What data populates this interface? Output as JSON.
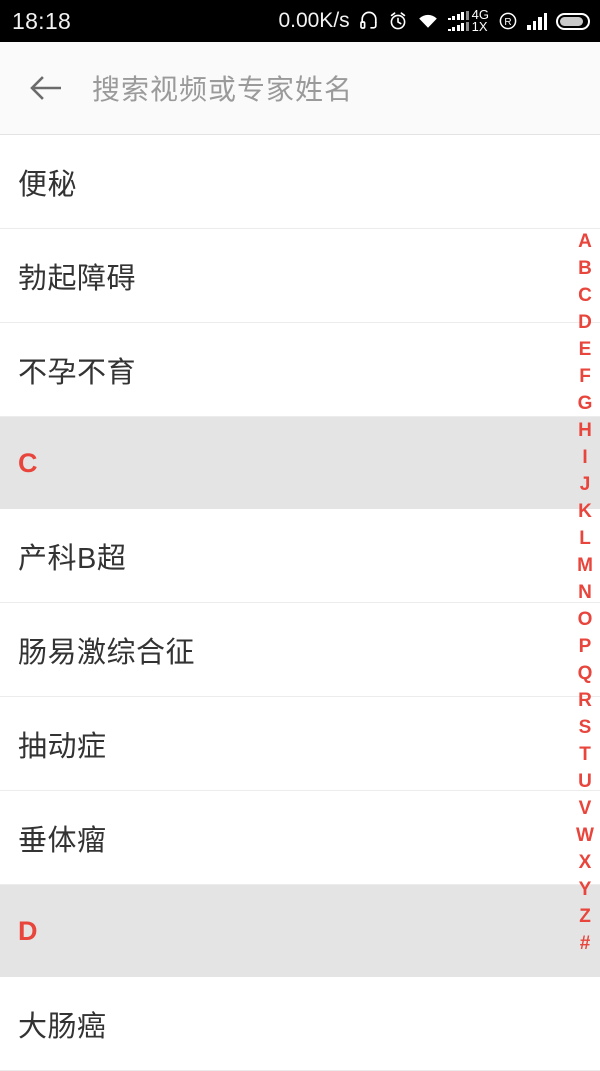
{
  "status_bar": {
    "time": "18:18",
    "net_speed": "0.00K/s",
    "icons": [
      "headphone-icon",
      "alarm-clock-icon",
      "wifi-icon",
      "dual-sim-signal-icon",
      "roaming-icon",
      "cellular-signal-icon",
      "battery-icon"
    ],
    "sim_label_primary": "4G",
    "sim_label_secondary": "1X",
    "roaming_label": "R"
  },
  "search": {
    "back_icon": "back-arrow-icon",
    "placeholder": "搜索视频或专家姓名"
  },
  "list": [
    {
      "type": "item",
      "label": "便秘"
    },
    {
      "type": "item",
      "label": "勃起障碍"
    },
    {
      "type": "item",
      "label": "不孕不育"
    },
    {
      "type": "section",
      "label": "C"
    },
    {
      "type": "item",
      "label": "产科B超"
    },
    {
      "type": "item",
      "label": "肠易激综合征"
    },
    {
      "type": "item",
      "label": "抽动症"
    },
    {
      "type": "item",
      "label": "垂体瘤"
    },
    {
      "type": "section",
      "label": "D"
    },
    {
      "type": "item",
      "label": "大肠癌"
    }
  ],
  "alpha_index": {
    "letters": [
      "A",
      "B",
      "C",
      "D",
      "E",
      "F",
      "G",
      "H",
      "I",
      "J",
      "K",
      "L",
      "M",
      "N",
      "O",
      "P",
      "Q",
      "R",
      "S",
      "T",
      "U",
      "V",
      "W",
      "X",
      "Y",
      "Z",
      "#"
    ]
  },
  "colors": {
    "accent_red": "#e8453c",
    "section_bg": "#e4e4e4",
    "search_bg": "#fafafa",
    "text_primary": "#333333",
    "text_placeholder": "#9a9a9a"
  }
}
